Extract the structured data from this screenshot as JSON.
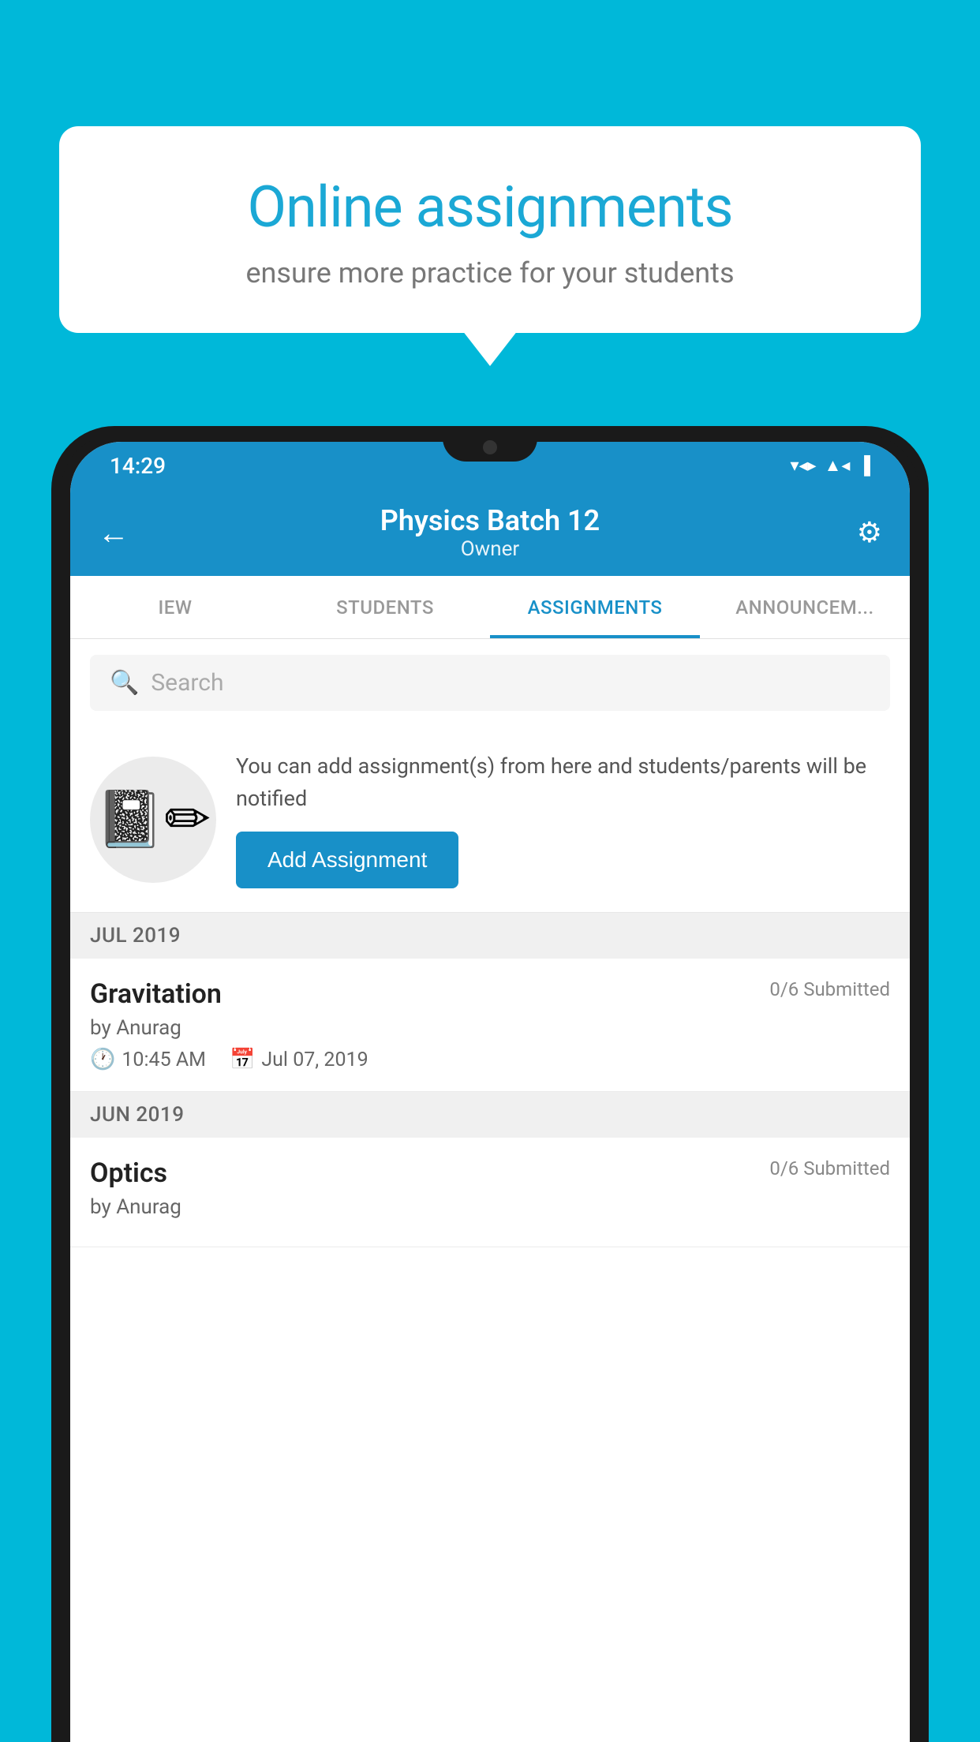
{
  "background_color": "#00b8d9",
  "bubble": {
    "title": "Online assignments",
    "subtitle": "ensure more practice for your students"
  },
  "status_bar": {
    "time": "14:29",
    "icons": [
      "wifi",
      "signal",
      "battery"
    ]
  },
  "app_bar": {
    "title": "Physics Batch 12",
    "subtitle": "Owner",
    "back_label": "←",
    "settings_label": "⚙"
  },
  "tabs": [
    {
      "label": "IEW",
      "active": false
    },
    {
      "label": "STUDENTS",
      "active": false
    },
    {
      "label": "ASSIGNMENTS",
      "active": true
    },
    {
      "label": "ANNOUNCEM...",
      "active": false
    }
  ],
  "search": {
    "placeholder": "Search"
  },
  "promo": {
    "description": "You can add assignment(s) from here and students/parents will be notified",
    "button_label": "Add Assignment"
  },
  "sections": [
    {
      "month": "JUL 2019",
      "assignments": [
        {
          "name": "Gravitation",
          "submitted": "0/6 Submitted",
          "author": "by Anurag",
          "time": "10:45 AM",
          "date": "Jul 07, 2019"
        }
      ]
    },
    {
      "month": "JUN 2019",
      "assignments": [
        {
          "name": "Optics",
          "submitted": "0/6 Submitted",
          "author": "by Anurag",
          "time": "",
          "date": ""
        }
      ]
    }
  ]
}
